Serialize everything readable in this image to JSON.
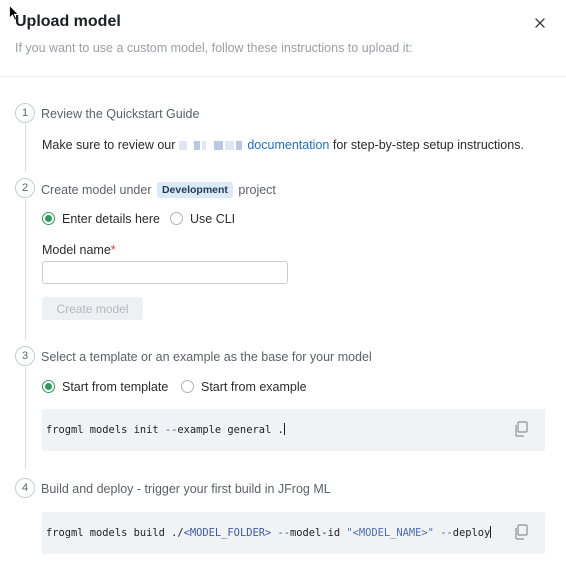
{
  "modal": {
    "title": "Upload model",
    "subtitle": "If you want to use a custom model, follow these instructions to upload it:"
  },
  "steps": [
    {
      "number": "1",
      "title": "Review the Quickstart Guide",
      "text_before": "Make sure to review our",
      "link_text": "documentation",
      "text_after": "for step-by-step setup instructions."
    },
    {
      "number": "2",
      "title_before": "Create model under",
      "tag": "Development",
      "title_after": "project",
      "radio_options": [
        "Enter details here",
        "Use CLI"
      ],
      "selected_option": "Enter details here",
      "field_label": "Model name",
      "required_mark": "*",
      "field_value": "",
      "button_label": "Create model"
    },
    {
      "number": "3",
      "title": "Select a template or an example as the base for your model",
      "radio_options": [
        "Start from template",
        "Start from example"
      ],
      "selected_option": "Start from template",
      "code": {
        "cmd": "frogml models init ",
        "flag": "--",
        "flag_name": "example general ."
      }
    },
    {
      "number": "4",
      "title": "Build and deploy - trigger your first build in JFrog ML",
      "code": {
        "cmd": "frogml models build ./",
        "folder": "<MODEL_FOLDER>",
        "flag1_dash": " --",
        "flag1_name": "model-",
        "flag1_id": "id ",
        "name_value": "\"<MODEL_NAME>\"",
        "flag2_dash": " --",
        "flag2_name": "deploy"
      }
    }
  ],
  "colors": {
    "accent_green": "#2e9b5c",
    "link_blue": "#1f6fc5",
    "tag_bg": "#dbe9f8"
  },
  "icons": {
    "close": "close-icon",
    "copy": "copy-icon",
    "cursor": "mouse-cursor-icon"
  }
}
